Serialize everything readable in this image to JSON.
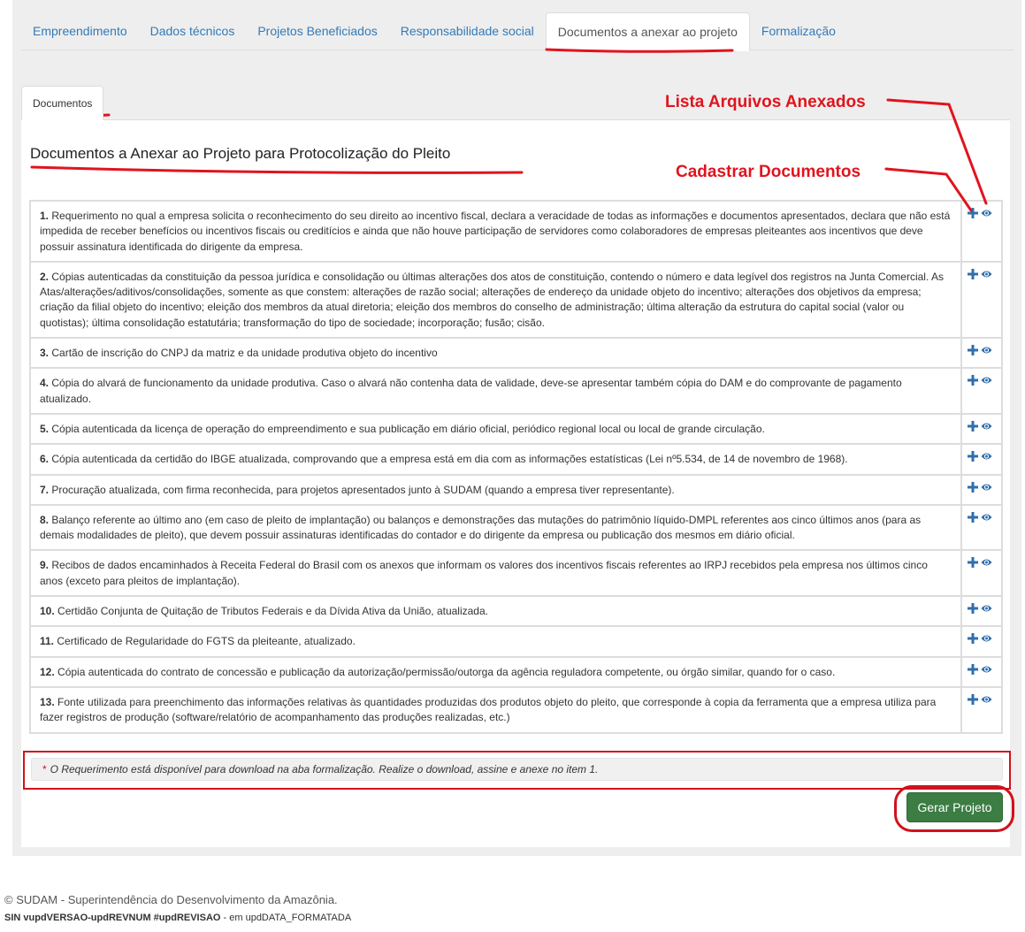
{
  "tabs": [
    {
      "label": "Empreendimento",
      "active": false
    },
    {
      "label": "Dados técnicos",
      "active": false
    },
    {
      "label": "Projetos Beneficiados",
      "active": false
    },
    {
      "label": "Responsabilidade social",
      "active": false
    },
    {
      "label": "Documentos a anexar ao projeto",
      "active": true
    },
    {
      "label": "Formalização",
      "active": false
    }
  ],
  "sub_tab": {
    "label": "Documentos"
  },
  "panel": {
    "title": "Documentos a Anexar ao Projeto para Protocolização do Pleito"
  },
  "documents": [
    {
      "num": "1.",
      "text": "Requerimento no qual a empresa solicita o reconhecimento do seu direito ao incentivo fiscal, declara a veracidade de todas as informações e documentos apresentados, declara que não está impedida de receber benefícios ou incentivos fiscais ou creditícios e ainda que não houve participação de servidores como colaboradores de empresas pleiteantes aos incentivos que deve possuir assinatura identificada do dirigente da empresa."
    },
    {
      "num": "2.",
      "text": "Cópias autenticadas da constituição da pessoa jurídica e consolidação ou últimas alterações dos atos de constituição, contendo o número e data legível dos registros na Junta Comercial. As Atas/alterações/aditivos/consolidações, somente as que constem: alterações de razão social; alterações de endereço da unidade objeto do incentivo; alterações dos objetivos da empresa; criação da filial objeto do incentivo; eleição dos membros da atual diretoria; eleição dos membros do conselho de administração; última alteração da estrutura do capital social (valor ou quotistas); última consolidação estatutária; transformação do tipo de sociedade; incorporação; fusão; cisão."
    },
    {
      "num": "3.",
      "text": "Cartão de inscrição do CNPJ da matriz e da unidade produtiva objeto do incentivo"
    },
    {
      "num": "4.",
      "text": "Cópia do alvará de funcionamento da unidade produtiva. Caso o alvará não contenha data de validade, deve-se apresentar também cópia do DAM e do comprovante de pagamento atualizado."
    },
    {
      "num": "5.",
      "text": "Cópia autenticada da licença de operação do empreendimento e sua publicação em diário oficial, periódico regional local ou local de grande circulação."
    },
    {
      "num": "6.",
      "text": "Cópia autenticada da certidão do IBGE atualizada, comprovando que a empresa está em dia com as informações estatísticas (Lei nº5.534, de 14 de novembro de 1968)."
    },
    {
      "num": "7.",
      "text": "Procuração atualizada, com firma reconhecida, para projetos apresentados junto à SUDAM (quando a empresa tiver representante)."
    },
    {
      "num": "8.",
      "text": "Balanço referente ao último ano (em caso de pleito de implantação) ou balanços e demonstrações das mutações do patrimônio líquido-DMPL referentes aos cinco últimos anos (para as demais modalidades de pleito), que devem possuir assinaturas identificadas do contador e do dirigente da empresa ou publicação dos mesmos em diário oficial."
    },
    {
      "num": "9.",
      "text": "Recibos de dados encaminhados à Receita Federal do Brasil com os anexos que informam os valores dos incentivos fiscais referentes ao IRPJ recebidos pela empresa nos últimos cinco anos (exceto para pleitos de implantação)."
    },
    {
      "num": "10.",
      "text": "Certidão Conjunta de Quitação de Tributos Federais e da Dívida Ativa da União, atualizada."
    },
    {
      "num": "11.",
      "text": "Certificado de Regularidade do FGTS da pleiteante, atualizado."
    },
    {
      "num": "12.",
      "text": "Cópia autenticada do contrato de concessão e publicação da autorização/permissão/outorga da agência reguladora competente, ou órgão similar, quando for o caso."
    },
    {
      "num": "13.",
      "text": "Fonte utilizada para preenchimento das informações relativas às quantidades produzidas dos produtos objeto do pleito, que corresponde à copia da ferramenta que a empresa utiliza para fazer registros de produção (software/relatório de acompanhamento das produções realizadas, etc.)"
    }
  ],
  "note": {
    "star": "*",
    "text": "O Requerimento está disponível para download na aba formalização. Realize o download, assine e anexe no item 1."
  },
  "buttons": {
    "generate": "Gerar Projeto"
  },
  "annotations": {
    "list_files": "Lista Arquivos Anexados",
    "register_docs": "Cadastrar Documentos"
  },
  "footer": {
    "line1": "© SUDAM - Superintendência do Desenvolvimento da Amazônia.",
    "line2_bold": "SIN vupdVERSAO-updREVNUM #updREVISAO",
    "line2_rest": " - em updDATA_FORMATADA"
  },
  "icons": {
    "add": "plus-icon",
    "view": "eye-icon"
  },
  "colors": {
    "link": "#337ab7",
    "annotation": "#e0141e",
    "button": "#3b7d43",
    "icon": "#2f6fae"
  }
}
